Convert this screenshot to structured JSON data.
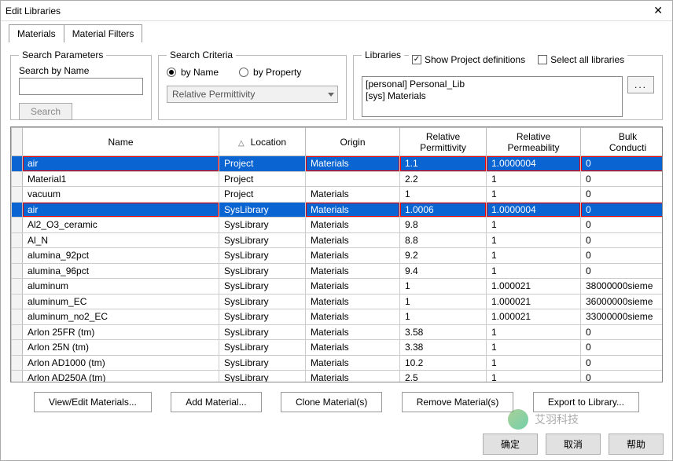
{
  "window": {
    "title": "Edit Libraries"
  },
  "tabs": {
    "materials": "Materials",
    "filters": "Material Filters"
  },
  "search_params": {
    "legend": "Search Parameters",
    "byname_label": "Search by Name",
    "search_btn": "Search"
  },
  "search_criteria": {
    "legend": "Search Criteria",
    "by_name": "by Name",
    "by_prop": "by Property",
    "combo": "Relative Permittivity"
  },
  "libraries_panel": {
    "legend": "Libraries",
    "show_project": "Show Project definitions",
    "select_all": "Select all libraries",
    "items": [
      "[personal] Personal_Lib",
      "[sys] Materials"
    ],
    "browse": "..."
  },
  "columns": [
    "Name",
    "Location",
    "Origin",
    "Relative Permittivity",
    "Relative Permeability",
    "Bulk Conducti"
  ],
  "rows": [
    {
      "n": "air",
      "loc": "Project",
      "orig": "Materials",
      "perm": "1.1",
      "permu": "1.0000004",
      "cond": "0",
      "sel": true
    },
    {
      "n": "Material1",
      "loc": "Project",
      "orig": "",
      "perm": "2.2",
      "permu": "1",
      "cond": "0",
      "sel": false
    },
    {
      "n": "vacuum",
      "loc": "Project",
      "orig": "Materials",
      "perm": "1",
      "permu": "1",
      "cond": "0",
      "sel": false
    },
    {
      "n": "air",
      "loc": "SysLibrary",
      "orig": "Materials",
      "perm": "1.0006",
      "permu": "1.0000004",
      "cond": "0",
      "sel": true
    },
    {
      "n": "Al2_O3_ceramic",
      "loc": "SysLibrary",
      "orig": "Materials",
      "perm": "9.8",
      "permu": "1",
      "cond": "0",
      "sel": false
    },
    {
      "n": "Al_N",
      "loc": "SysLibrary",
      "orig": "Materials",
      "perm": "8.8",
      "permu": "1",
      "cond": "0",
      "sel": false
    },
    {
      "n": "alumina_92pct",
      "loc": "SysLibrary",
      "orig": "Materials",
      "perm": "9.2",
      "permu": "1",
      "cond": "0",
      "sel": false
    },
    {
      "n": "alumina_96pct",
      "loc": "SysLibrary",
      "orig": "Materials",
      "perm": "9.4",
      "permu": "1",
      "cond": "0",
      "sel": false
    },
    {
      "n": "aluminum",
      "loc": "SysLibrary",
      "orig": "Materials",
      "perm": "1",
      "permu": "1.000021",
      "cond": "38000000sieme",
      "sel": false
    },
    {
      "n": "aluminum_EC",
      "loc": "SysLibrary",
      "orig": "Materials",
      "perm": "1",
      "permu": "1.000021",
      "cond": "36000000sieme",
      "sel": false
    },
    {
      "n": "aluminum_no2_EC",
      "loc": "SysLibrary",
      "orig": "Materials",
      "perm": "1",
      "permu": "1.000021",
      "cond": "33000000sieme",
      "sel": false
    },
    {
      "n": "Arlon 25FR (tm)",
      "loc": "SysLibrary",
      "orig": "Materials",
      "perm": "3.58",
      "permu": "1",
      "cond": "0",
      "sel": false
    },
    {
      "n": "Arlon 25N (tm)",
      "loc": "SysLibrary",
      "orig": "Materials",
      "perm": "3.38",
      "permu": "1",
      "cond": "0",
      "sel": false
    },
    {
      "n": "Arlon AD1000 (tm)",
      "loc": "SysLibrary",
      "orig": "Materials",
      "perm": "10.2",
      "permu": "1",
      "cond": "0",
      "sel": false
    },
    {
      "n": "Arlon AD250A (tm)",
      "loc": "SysLibrary",
      "orig": "Materials",
      "perm": "2.5",
      "permu": "1",
      "cond": "0",
      "sel": false
    }
  ],
  "lower": {
    "view": "View/Edit Materials...",
    "add": "Add Material...",
    "clone": "Clone Material(s)",
    "remove": "Remove Material(s)",
    "export": "Export to Library..."
  },
  "dialog": {
    "ok": "确定",
    "cancel": "取消",
    "help": "帮助"
  },
  "watermark": "艾羽科技"
}
